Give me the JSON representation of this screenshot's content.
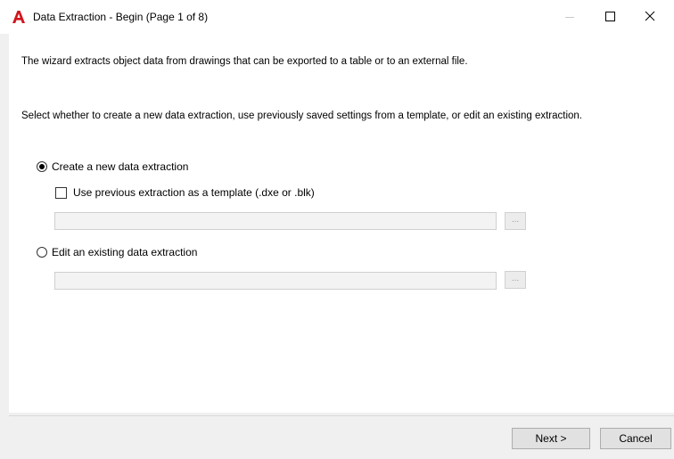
{
  "window": {
    "title": "Data Extraction - Begin (Page 1 of 8)",
    "app_icon": "autocad-logo-icon",
    "accent_color": "#d0161e"
  },
  "content": {
    "intro_text": "The wizard extracts object data from drawings that can be exported to a table or to an external file.",
    "instruction_text": "Select whether to create a new data extraction, use previously saved settings from a template, or edit an existing extraction.",
    "options": {
      "create_new": {
        "label": "Create a new data extraction",
        "selected": true
      },
      "use_template": {
        "label": "Use previous extraction as a template (.dxe or .blk)",
        "checked": false,
        "path_value": "",
        "browse_label": "..."
      },
      "edit_existing": {
        "label": "Edit an existing data extraction",
        "selected": false,
        "path_value": "",
        "browse_label": "..."
      }
    }
  },
  "footer": {
    "next_label": "Next >",
    "cancel_label": "Cancel"
  }
}
